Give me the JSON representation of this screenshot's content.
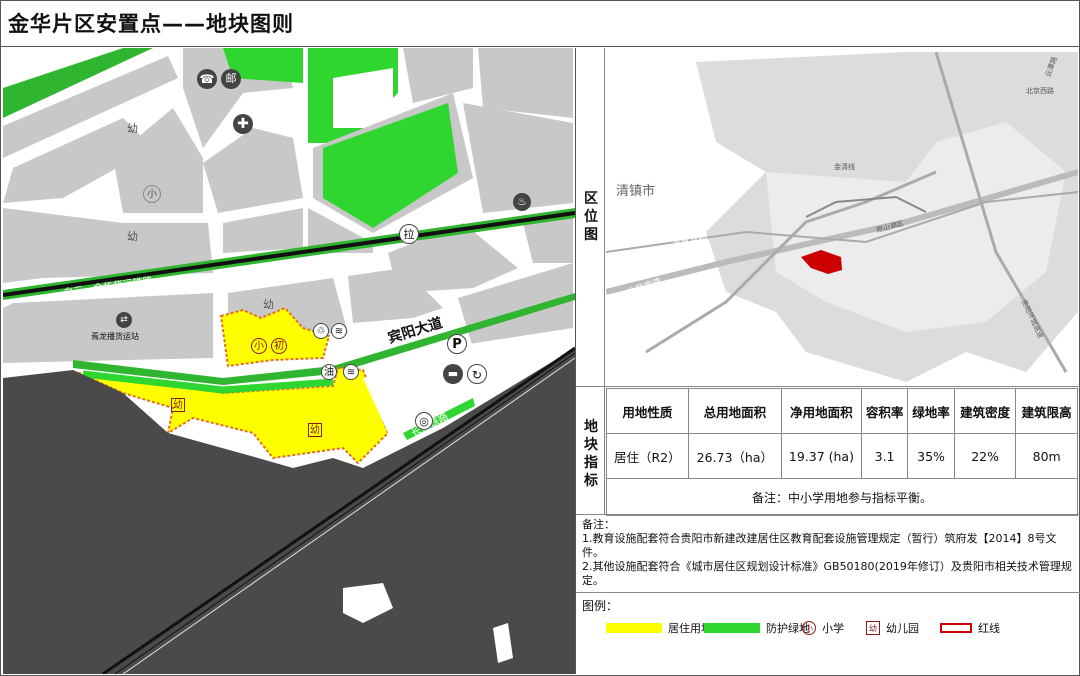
{
  "page_title": "金华片区安置点——地块图则",
  "map": {
    "labels": {
      "railway_green": "白云—金华货运铁路",
      "avenue": "宾阳大道",
      "station": "焉龙播货运站",
      "rail_bottom": "长昆铁路",
      "sites": [
        "幼",
        "幼",
        "幼",
        "幼",
        "小",
        "小",
        "初",
        "邮",
        "拉",
        "油"
      ]
    },
    "icons": [
      "phone-icon",
      "post-icon",
      "hospital-icon",
      "gas-icon",
      "recycle-icon",
      "parking-icon",
      "water-icon",
      "bus-icon",
      "train-station-icon"
    ],
    "colors": {
      "residential": "#ffff00",
      "green_buffer": "#2fb52f",
      "block": "#c8c8c8",
      "road": "#ffffff",
      "water_dark": "#4a4a4a",
      "boundary": "#e07020"
    }
  },
  "location": {
    "label": "区位图",
    "place_labels": [
      "清镇市",
      "清黄公路",
      "沪昆高速",
      "北京西路",
      "云潭路",
      "金清线",
      "观山湖区",
      "贵阳环城高速"
    ],
    "site_color": "#cc0000"
  },
  "indicators": {
    "label": "地块指标",
    "headers": [
      "用地性质",
      "总用地面积",
      "净用地面积",
      "容积率",
      "绿地率",
      "建筑密度",
      "建筑限高"
    ],
    "values": [
      "居住（R2）",
      "26.73（ha）",
      "19.37 (ha)",
      "3.1",
      "35%",
      "22%",
      "80m"
    ],
    "note": "备注：中小学用地参与指标平衡。"
  },
  "remarks": {
    "title": "备注：",
    "items": [
      "1.教育设施配套符合贵阳市新建改建居住区教育配套设施管理规定（暂行）筑府发【2014】8号文件。",
      "2.其他设施配套符合《城市居住区规划设计标准》GB50180(2019年修订）及贵阳市相关技术管理规定。"
    ]
  },
  "legend": {
    "title": "图例：",
    "items": [
      {
        "label": "居住用地",
        "color": "#ffff00"
      },
      {
        "label": "防护绿地",
        "color": "#2fd62f"
      },
      {
        "label": "小学",
        "glyph": "小"
      },
      {
        "label": "幼儿园",
        "glyph": "幼"
      },
      {
        "label": "红线",
        "color": "#cc0000"
      }
    ]
  }
}
